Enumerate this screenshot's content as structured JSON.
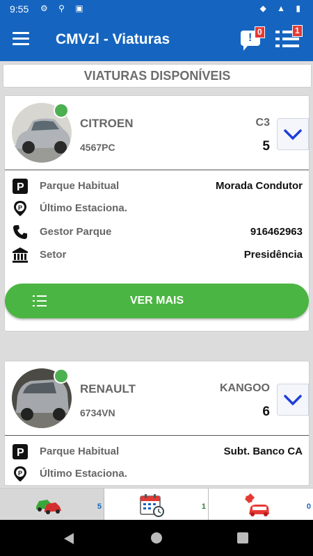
{
  "status_bar": {
    "time": "9:55"
  },
  "app_bar": {
    "title": "CMVzl - Viaturas",
    "notifications_count": "0",
    "list_count": "1"
  },
  "header": {
    "title": "VIATURAS DISPONÍVEIS"
  },
  "vehicles": [
    {
      "brand": "CITROEN",
      "model": "C3",
      "plate": "4567PC",
      "number": "5",
      "details": [
        {
          "label": "Parque Habitual",
          "value": "Morada Condutor"
        },
        {
          "label": "Último Estaciona.",
          "value": ""
        },
        {
          "label": "Gestor Parque",
          "value": "916462963"
        },
        {
          "label": "Setor",
          "value": "Presidência"
        }
      ],
      "button_label": "VER MAIS",
      "status_color": "#4caf50",
      "car_color": "#b0b4b8"
    },
    {
      "brand": "RENAULT",
      "model": "KANGOO",
      "plate": "6734VN",
      "number": "6",
      "details": [
        {
          "label": "Parque Habitual",
          "value": "Subt. Banco CA"
        },
        {
          "label": "Último Estaciona.",
          "value": ""
        }
      ],
      "status_color": "#4caf50",
      "car_color": "#a4a8ac"
    }
  ],
  "bottom_tabs": [
    {
      "icon": "cars-icon",
      "count": "5",
      "count_color": "#1565c0"
    },
    {
      "icon": "calendar-clock-icon",
      "count": "1",
      "count_color": "#2e7d32"
    },
    {
      "icon": "car-repair-icon",
      "count": "0",
      "count_color": "#1565c0"
    }
  ],
  "colors": {
    "primary": "#1565c0",
    "accent_green": "#4bb543",
    "badge_red": "#e53935"
  }
}
